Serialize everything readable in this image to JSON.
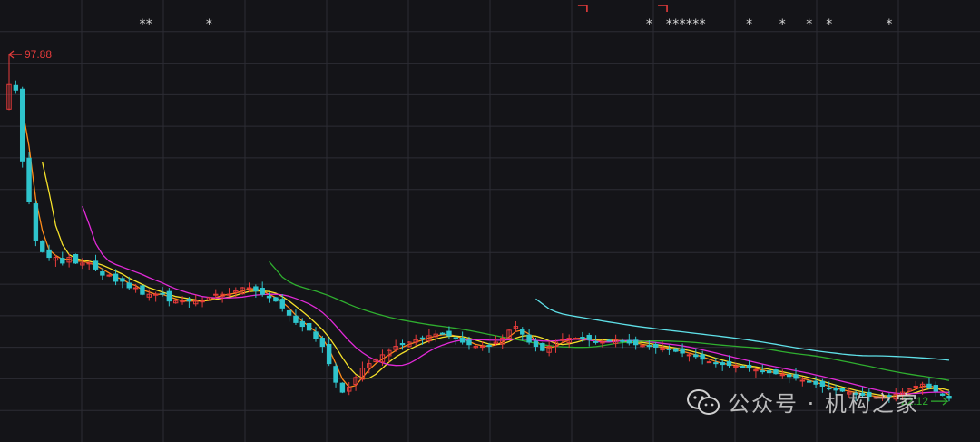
{
  "chart_data": {
    "type": "candlestick",
    "title": "",
    "xlabel": "",
    "ylabel": "",
    "grid": true,
    "y_scale": "log",
    "ylim": [
      20,
      110
    ],
    "max_label": "97.88",
    "min_label": "22.12",
    "markers": [
      {
        "index": 20,
        "symbol": "*"
      },
      {
        "index": 21,
        "symbol": "*"
      },
      {
        "index": 30,
        "symbol": "*"
      },
      {
        "index": 96,
        "symbol": "*"
      },
      {
        "index": 99,
        "symbol": "*"
      },
      {
        "index": 100,
        "symbol": "*"
      },
      {
        "index": 101,
        "symbol": "*"
      },
      {
        "index": 102,
        "symbol": "*"
      },
      {
        "index": 103,
        "symbol": "*"
      },
      {
        "index": 104,
        "symbol": "*"
      },
      {
        "index": 111,
        "symbol": "*"
      },
      {
        "index": 116,
        "symbol": "*"
      },
      {
        "index": 120,
        "symbol": "*"
      },
      {
        "index": 123,
        "symbol": "*"
      },
      {
        "index": 132,
        "symbol": "*"
      }
    ],
    "top_flags": [
      {
        "index": 86
      },
      {
        "index": 98
      }
    ],
    "colors": {
      "up": "#e53b3b",
      "down": "#2fc4cc",
      "ma_orange": "#ff8c1a",
      "ma_yellow": "#f5e12a",
      "ma_magenta": "#e22ad8",
      "ma_green": "#2fae2f",
      "ma_cyan": "#5fe0e8",
      "grid": "#2c2c34",
      "background": "#141418",
      "marker": "#d8d8d8"
    },
    "close": [
      86,
      84,
      62,
      52,
      44,
      42,
      41,
      41,
      40,
      41,
      40,
      40,
      40,
      39,
      38,
      38,
      37,
      37,
      36,
      36,
      35,
      35,
      35,
      35,
      34,
      34,
      34,
      34,
      34,
      34,
      34.5,
      35,
      35,
      35,
      35.5,
      36,
      36,
      35.5,
      35,
      34.5,
      34,
      33,
      32,
      31,
      30.5,
      30,
      29,
      28,
      26,
      24,
      23,
      23.5,
      24.5,
      25.5,
      26,
      26.5,
      27,
      27.5,
      28,
      28.2,
      28.5,
      28.8,
      29,
      29.3,
      29.5,
      29.5,
      29.3,
      29,
      28.5,
      28.2,
      28,
      28,
      28,
      28.5,
      29,
      30,
      30.5,
      29.5,
      28.5,
      28,
      27.5,
      28,
      28.5,
      28.8,
      29,
      29,
      29,
      28.8,
      28.5,
      28.5,
      28.7,
      28.8,
      28.6,
      28.4,
      28.2,
      28.1,
      28,
      27.9,
      27.8,
      27.6,
      27.4,
      27.2,
      27,
      26.8,
      26.5,
      26.2,
      26,
      25.9,
      25.8,
      25.7,
      25.6,
      25.5,
      25.3,
      25.1,
      25,
      24.9,
      24.8,
      24.6,
      24.4,
      24.2,
      24,
      23.8,
      23.6,
      23.4,
      23.2,
      23.1,
      23,
      22.8,
      22.7,
      22.6,
      22.5,
      22.5,
      22.6,
      22.8,
      23,
      23.3,
      23.6,
      23.8,
      23.5,
      23.1,
      22.7,
      22.4
    ]
  }
}
